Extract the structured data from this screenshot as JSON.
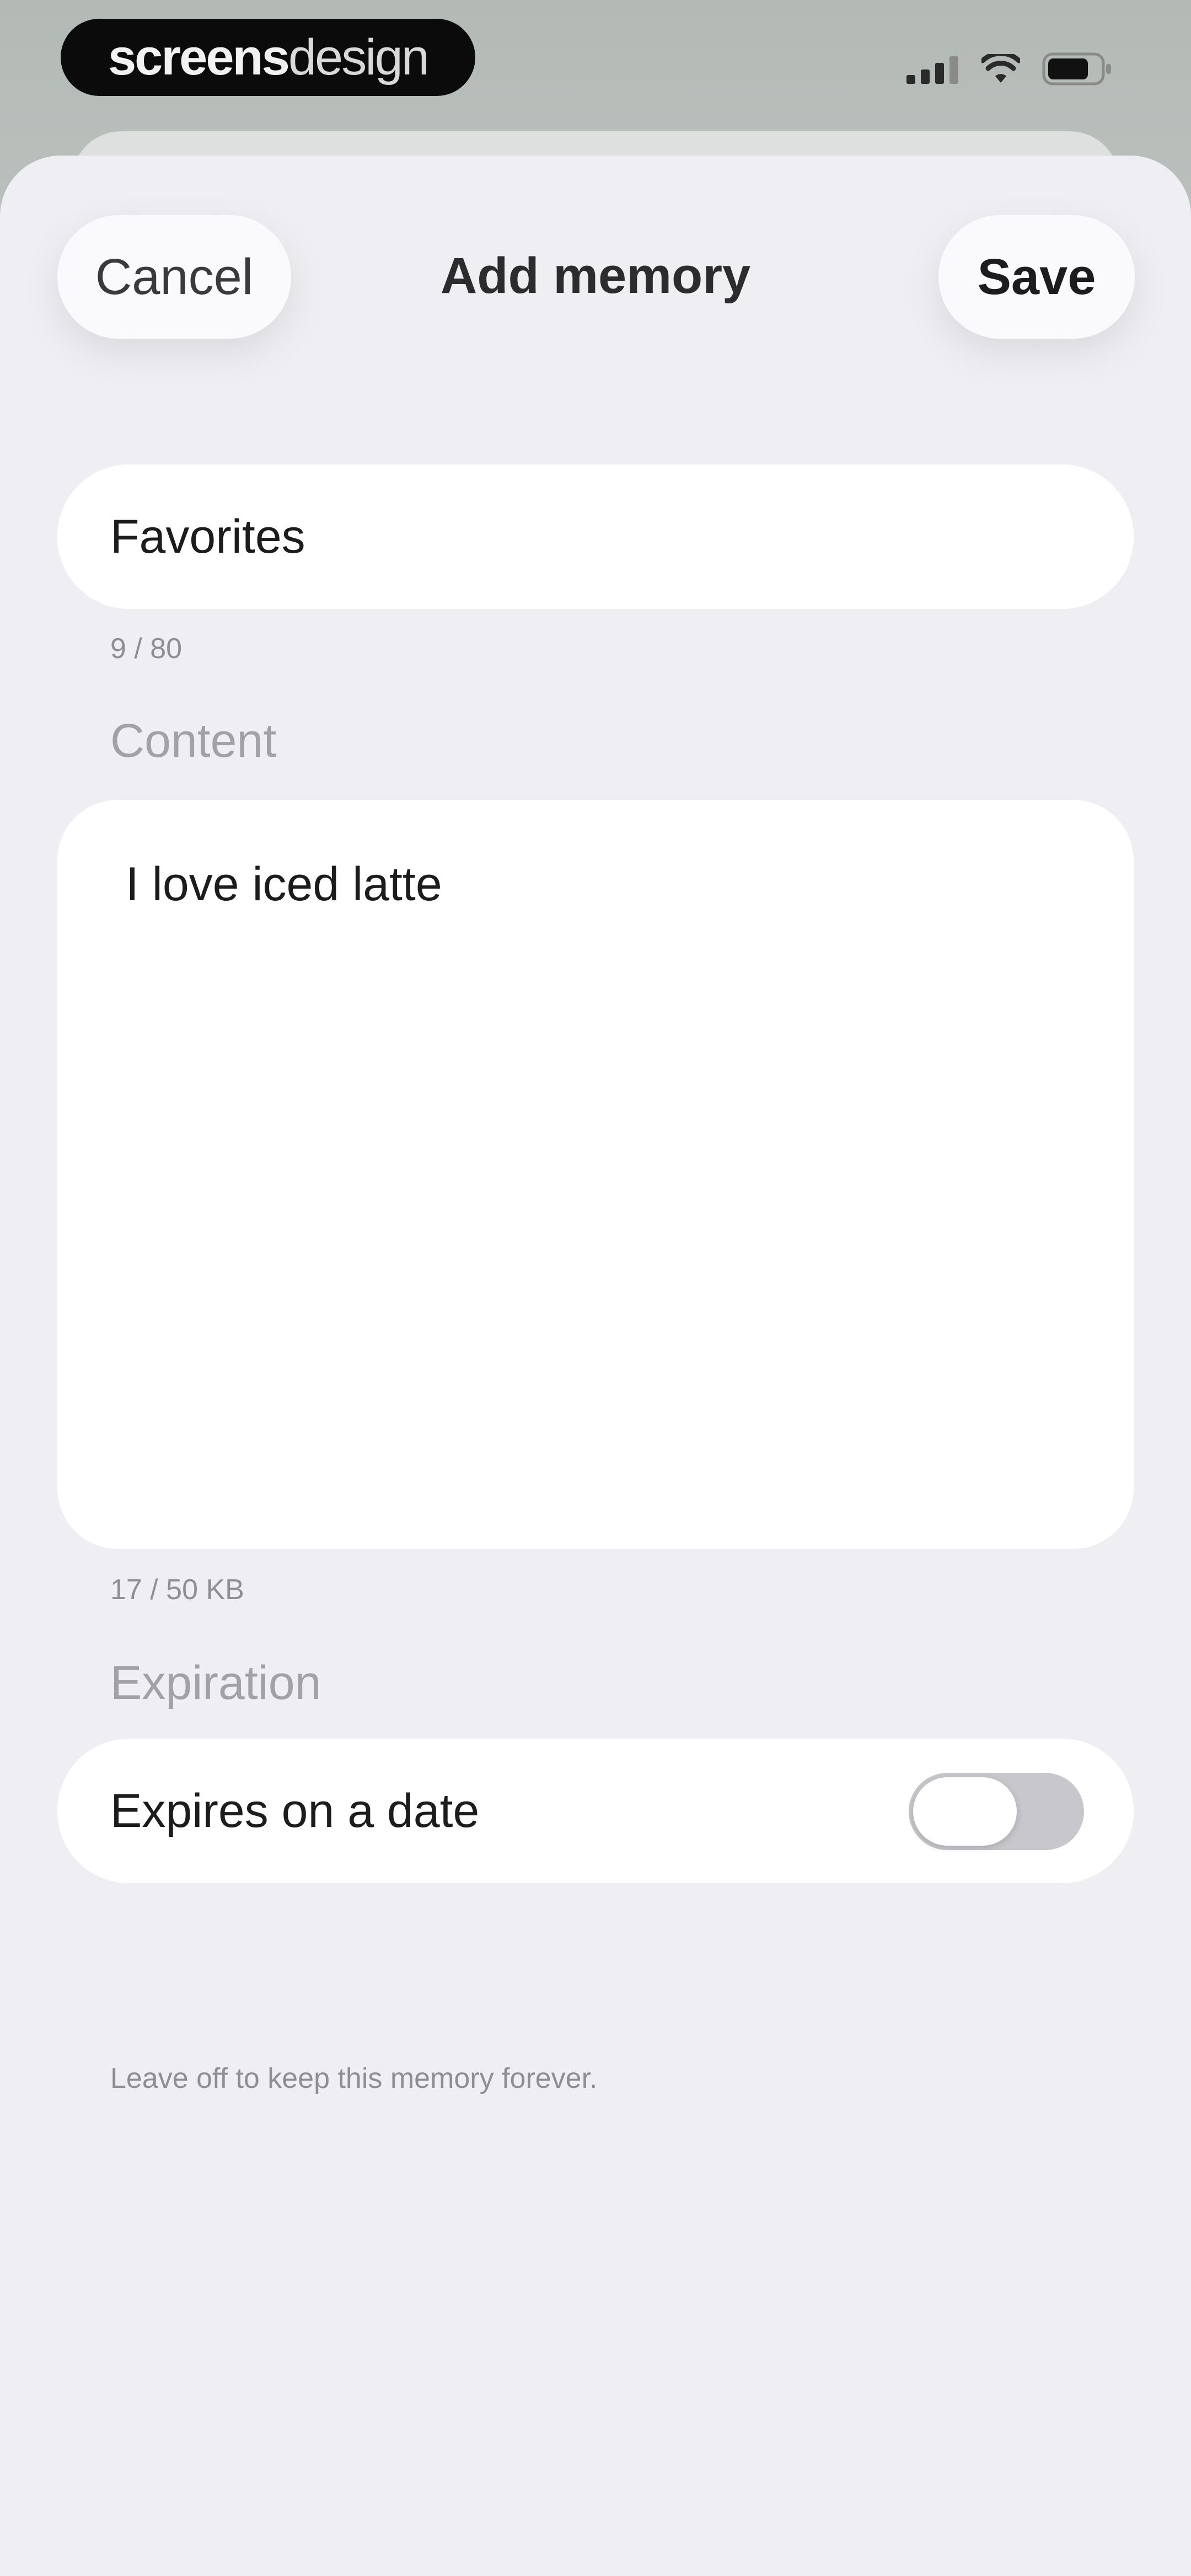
{
  "status_bar": {
    "brand_part1": "screens",
    "brand_part2": "design",
    "icons": [
      "signal-icon",
      "wifi-icon",
      "battery-icon"
    ]
  },
  "header": {
    "cancel_label": "Cancel",
    "title": "Add memory",
    "save_label": "Save"
  },
  "title_field": {
    "value": "Favorites",
    "counter": "9 / 80"
  },
  "content": {
    "label": "Content",
    "value": "I love iced latte",
    "counter": "17 / 50 KB"
  },
  "expiration": {
    "label": "Expiration",
    "toggle_label": "Expires on a date",
    "toggle_on": false,
    "hint": "Leave off to keep this memory forever."
  },
  "colors": {
    "sheet_background": "#efeff3",
    "field_background": "#ffffff",
    "toggle_off": "#c7c7cc"
  }
}
